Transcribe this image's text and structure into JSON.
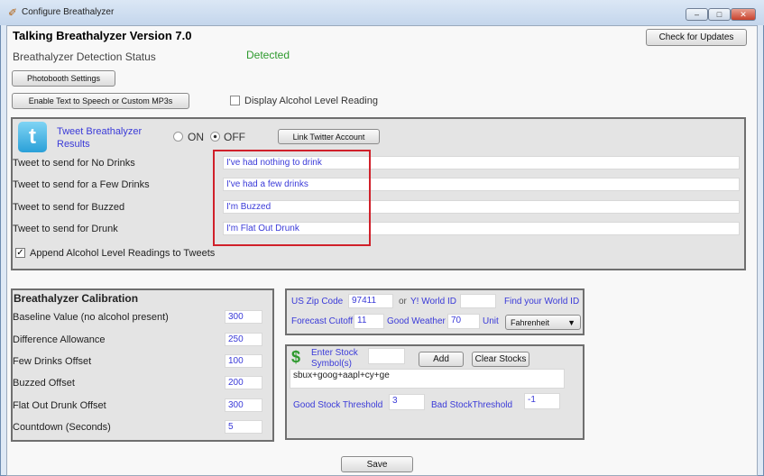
{
  "window": {
    "title": "Configure Breathalyzer",
    "minimize": "–",
    "maximize": "□",
    "close": "✕"
  },
  "header": {
    "title": "Talking Breathalyzer Version 7.0",
    "check_updates": "Check for Updates",
    "detection_label": "Breathalyzer Detection Status",
    "detection_status": "Detected",
    "photobooth": "Photobooth Settings",
    "tts": "Enable Text to Speech or Custom MP3s",
    "display_alcohol": "Display Alcohol Level Reading",
    "display_alcohol_checked": false
  },
  "twitter": {
    "title_line1": "Tweet Breathalyzer",
    "title_line2": "Results",
    "on": "ON",
    "off": "OFF",
    "selected": "OFF",
    "link": "Link Twitter Account",
    "rows": [
      {
        "label": "Tweet to send for No Drinks",
        "value": "I've had nothing to drink"
      },
      {
        "label": "Tweet to send for a Few Drinks",
        "value": "I've had a few drinks"
      },
      {
        "label": "Tweet to send for Buzzed",
        "value": "I'm Buzzed"
      },
      {
        "label": "Tweet to send for Drunk",
        "value": "I'm Flat Out Drunk"
      }
    ],
    "append": "Append Alcohol Level Readings to Tweets",
    "append_checked": true
  },
  "calibration": {
    "title": "Breathalyzer Calibration",
    "rows": [
      {
        "label": "Baseline Value (no alcohol present)",
        "value": "300"
      },
      {
        "label": "Difference Allowance",
        "value": "250"
      },
      {
        "label": "Few Drinks Offset",
        "value": "100"
      },
      {
        "label": "Buzzed Offset",
        "value": "200"
      },
      {
        "label": "Flat Out Drunk Offset",
        "value": "300"
      },
      {
        "label": "Countdown (Seconds)",
        "value": "5"
      }
    ]
  },
  "weather": {
    "zip_label": "US Zip Code",
    "zip": "97411",
    "or": "or",
    "world_label": "Y! World ID",
    "world": "",
    "find": "Find your World ID",
    "cutoff_label": "Forecast Cutoff",
    "cutoff": "11",
    "good_label": "Good Weather",
    "good": "70",
    "unit_label": "Unit",
    "unit": "Fahrenheit"
  },
  "stocks": {
    "enter_line1": "Enter Stock",
    "enter_line2": "Symbol(s)",
    "symbol": "",
    "add": "Add",
    "clear": "Clear Stocks",
    "list": "sbux+goog+aapl+cy+ge",
    "good_label": "Good Stock Threshold",
    "good": "3",
    "bad_label": "Bad StockThreshold",
    "bad": "-1"
  },
  "save": "Save",
  "colors": {
    "accent": "#3a3ad8",
    "detected": "#2e9a2e",
    "highlight": "#d0202a"
  }
}
